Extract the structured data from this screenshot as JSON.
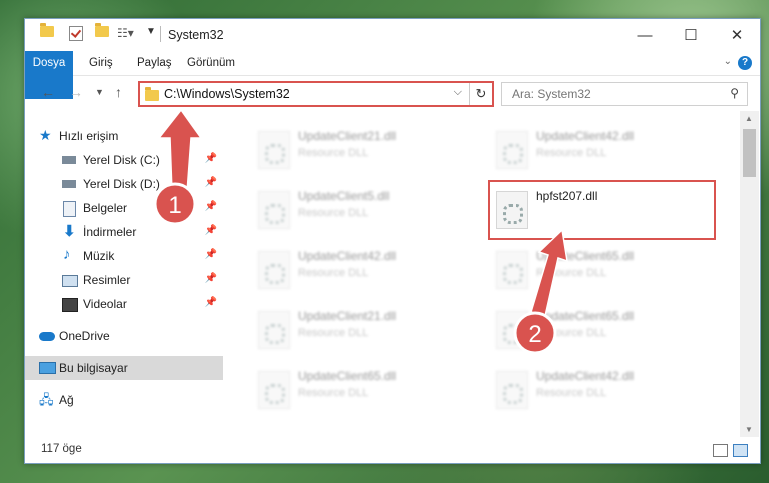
{
  "window": {
    "title": "System32",
    "controls": [
      "minimize-icon",
      "maximize-icon",
      "close-icon"
    ]
  },
  "ribbon": {
    "tabs": [
      "Dosya",
      "Giriş",
      "Paylaş",
      "Görünüm"
    ],
    "help": "?"
  },
  "address": {
    "path": "C:\\Windows\\System32"
  },
  "search": {
    "placeholder": "Ara: System32"
  },
  "nav": {
    "items": [
      {
        "label": "Hızlı erişim",
        "icon": "star-icon",
        "pinned": false
      },
      {
        "label": "Yerel Disk (C:)",
        "icon": "drive-icon",
        "pinned": true
      },
      {
        "label": "Yerel Disk (D:)",
        "icon": "drive-icon",
        "pinned": true
      },
      {
        "label": "Belgeler",
        "icon": "documents-icon",
        "pinned": true
      },
      {
        "label": "İndirmeler",
        "icon": "download-icon",
        "pinned": true
      },
      {
        "label": "Müzik",
        "icon": "music-icon",
        "pinned": true
      },
      {
        "label": "Resimler",
        "icon": "pictures-icon",
        "pinned": true
      },
      {
        "label": "Videolar",
        "icon": "videos-icon",
        "pinned": true
      },
      {
        "label": "OneDrive",
        "icon": "cloud-icon",
        "pinned": false
      },
      {
        "label": "Bu bilgisayar",
        "icon": "computer-icon",
        "pinned": false,
        "selected": true
      },
      {
        "label": "Ağ",
        "icon": "network-icon",
        "pinned": false
      }
    ]
  },
  "files": [
    {
      "name": "UpdateClient21.dll",
      "type": "Resource DLL"
    },
    {
      "name": "UpdateClient42.dll",
      "type": "Resource DLL"
    },
    {
      "name": "UpdateClient5.dll",
      "type": "Resource DLL"
    },
    {
      "name": "hpfst207.dll",
      "type": ""
    },
    {
      "name": "UpdateClient42.dll",
      "type": "Resource DLL"
    },
    {
      "name": "UpdateClient65.dll",
      "type": "Resource DLL"
    },
    {
      "name": "UpdateClient21.dll",
      "type": "Resource DLL"
    },
    {
      "name": "UpdateClient65.dll",
      "type": "Resource DLL"
    },
    {
      "name": "UpdateClient65.dll",
      "type": "Resource DLL"
    },
    {
      "name": "UpdateClient42.dll",
      "type": "Resource DLL"
    }
  ],
  "status": {
    "count": "117 öge"
  },
  "annotations": {
    "step1": "1",
    "step2": "2",
    "color": "#d9534f"
  }
}
